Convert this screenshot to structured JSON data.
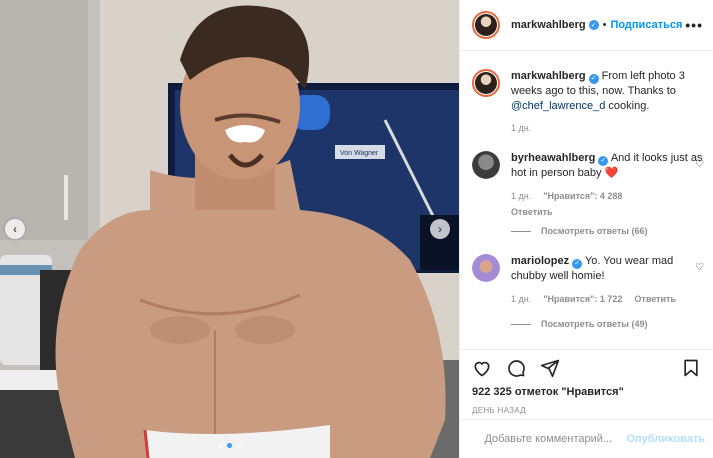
{
  "post": {
    "author": "markwahlberg",
    "follow_label": "Подписаться",
    "separator": "•",
    "more_label": "•••",
    "caption": {
      "username": "markwahlberg",
      "text_before": "From left photo 3 weeks ago to this, now. Thanks to ",
      "mention": "@chef_lawrence_d",
      "text_after": " cooking.",
      "time": "1 дн."
    },
    "photo": {
      "prev_arrow": "‹",
      "next_arrow": "›",
      "tv_caption": "Von Wagner",
      "slide_count": 3,
      "active_slide": 2
    },
    "comments": [
      {
        "username": "byrheawahlberg",
        "text": "And it looks just as hot in person baby",
        "emoji": "❤️",
        "time": "1 дн.",
        "likes": "\"Нравится\": 4 288",
        "reply_label": "Ответить",
        "view_replies": "Посмотреть ответы (66)"
      },
      {
        "username": "mariolopez",
        "text": "Yo. You wear mad chubby well homie!",
        "time": "1 дн.",
        "likes": "\"Нравится\": 1 722",
        "reply_label": "Ответить",
        "view_replies": "Посмотреть ответы (49)"
      }
    ],
    "likes_text": "922 325 отметок \"Нравится\"",
    "posted_time": "ДЕНЬ НАЗАД",
    "add_comment_placeholder": "Добавьте комментарий...",
    "publish_label": "Опубликовать",
    "colors": {
      "accent": "#0095f6",
      "verified": "#3897f0",
      "heart_red": "#ed4956",
      "muted": "#8e8e8e"
    }
  }
}
